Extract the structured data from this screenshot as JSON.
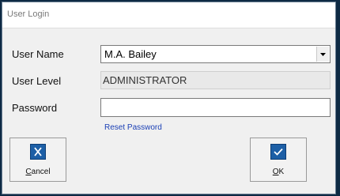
{
  "window": {
    "title": "User Login"
  },
  "form": {
    "user_name_label": "User Name",
    "user_name_value": "M.A. Bailey",
    "user_level_label": "User Level",
    "user_level_value": "ADMINISTRATOR",
    "password_label": "Password",
    "password_value": ""
  },
  "reset_password_label": "Reset Password",
  "buttons": {
    "cancel": {
      "mnemonic": "C",
      "rest": "ancel",
      "icon": "x-icon"
    },
    "ok": {
      "mnemonic": "O",
      "rest": "K",
      "icon": "check-icon"
    }
  },
  "colors": {
    "backdrop": "#0e2a44",
    "button_icon": "#1d5fa6",
    "link": "#1a3fb5"
  }
}
